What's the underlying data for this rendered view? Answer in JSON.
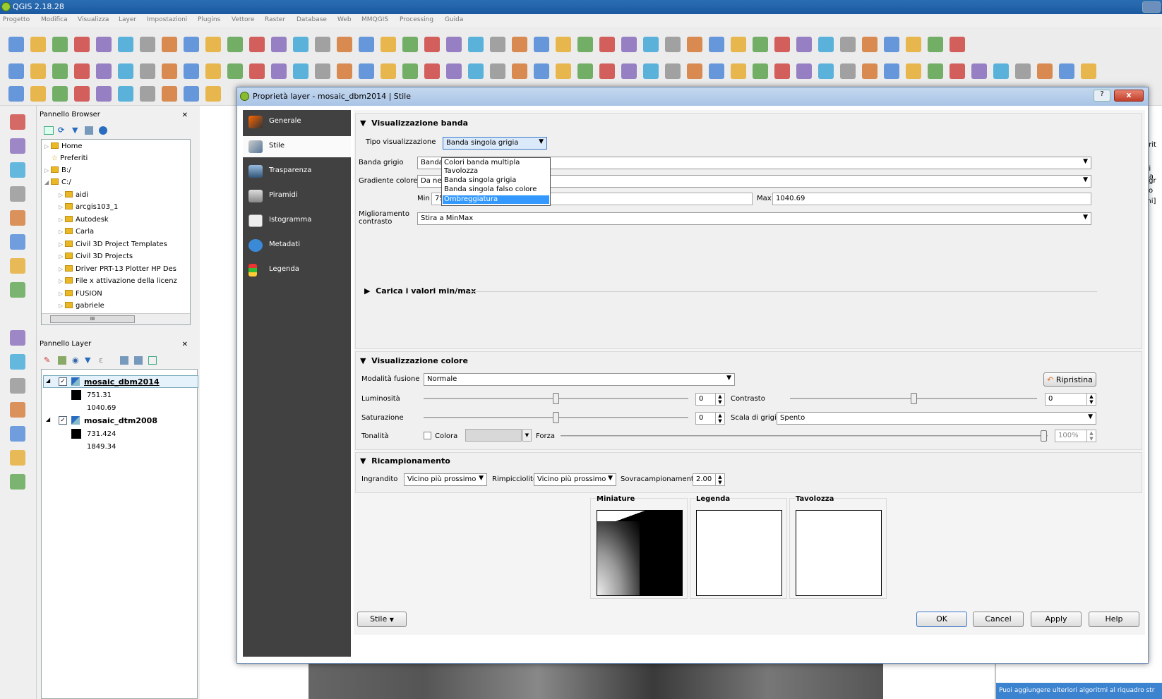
{
  "app": {
    "title": "QGIS 2.18.28"
  },
  "menu": [
    "Progetto",
    "Modifica",
    "Visualizza",
    "Layer",
    "Impostazioni",
    "Plugins",
    "Vettore",
    "Raster",
    "Database",
    "Web",
    "MMQGIS",
    "Processing",
    "Guida"
  ],
  "browser": {
    "title": "Pannello Browser",
    "items": [
      "Home",
      "Preferiti",
      "B:/",
      "C:/",
      "aidi",
      "arcgis103_1",
      "Autodesk",
      "Carla",
      "Civil 3D Project Templates",
      "Civil 3D Projects",
      "Driver PRT-13 Plotter HP Des",
      "File x attivazione della licenz",
      "FUSION",
      "gabriele"
    ],
    "scroll_label": "III"
  },
  "layers": {
    "title": "Pannello Layer",
    "items": [
      {
        "name": "mosaic_dbm2014",
        "min": "751.31",
        "max": "1040.69"
      },
      {
        "name": "mosaic_dtm2008",
        "min": "731.424",
        "max": "1849.34"
      }
    ]
  },
  "right_panel": {
    "fragments": [
      "orit",
      "di Ra",
      "egr",
      "i o",
      "mi]"
    ],
    "status": "Puoi aggiungere ulteriori algoritmi al riquadro str"
  },
  "dialog": {
    "title": "Proprietà layer - mosaic_dbm2014 | Stile",
    "help": "?",
    "close": "x",
    "nav": [
      "Generale",
      "Stile",
      "Trasparenza",
      "Piramidi",
      "Istogramma",
      "Metadati",
      "Legenda"
    ],
    "band": {
      "header": "Visualizzazione banda",
      "type_label": "Tipo visualizzazione",
      "type_value": "Banda singola grigia",
      "gray_label": "Banda grigio",
      "gray_value": "Banda 1 (Gray)",
      "gradient_label": "Gradiente colore",
      "gradient_value": "Da nero a bianco",
      "min_label": "Min",
      "min_value": "751.31",
      "max_label": "Max",
      "max_value": "1040.69",
      "contrast_label": "Miglioramento contrasto",
      "contrast_value": "Stira a MinMax",
      "load_minmax": "Carica i valori min/max"
    },
    "dropdown_options": [
      "Colori banda multipla",
      "Tavolozza",
      "Banda singola grigia",
      "Banda singola falso colore",
      "Ombreggiatura"
    ],
    "color": {
      "header": "Visualizzazione colore",
      "blend_label": "Modalità fusione",
      "blend_value": "Normale",
      "reset": "Ripristina",
      "brightness_label": "Luminosità",
      "brightness_value": "0",
      "contrast_label": "Contrasto",
      "contrast_value": "0",
      "saturation_label": "Saturazione",
      "saturation_value": "0",
      "grayscale_label": "Scala di grigi",
      "grayscale_value": "Spento",
      "hue_label": "Tonalità",
      "colorize_label": "Colora",
      "strength_label": "Forza",
      "strength_value": "100%"
    },
    "resampling": {
      "header": "Ricampionamento",
      "zoomin_label": "Ingrandito",
      "zoomin_value": "Vicino più prossimo",
      "zoomout_label": "Rimpicciolito",
      "zoomout_value": "Vicino più prossimo",
      "oversampling_label": "Sovracampionamento",
      "oversampling_value": "2.00"
    },
    "previews": {
      "thumb": "Miniature",
      "legend": "Legenda",
      "palette": "Tavolozza"
    },
    "buttons": {
      "style": "Stile",
      "ok": "OK",
      "cancel": "Cancel",
      "apply": "Apply",
      "help": "Help"
    }
  }
}
